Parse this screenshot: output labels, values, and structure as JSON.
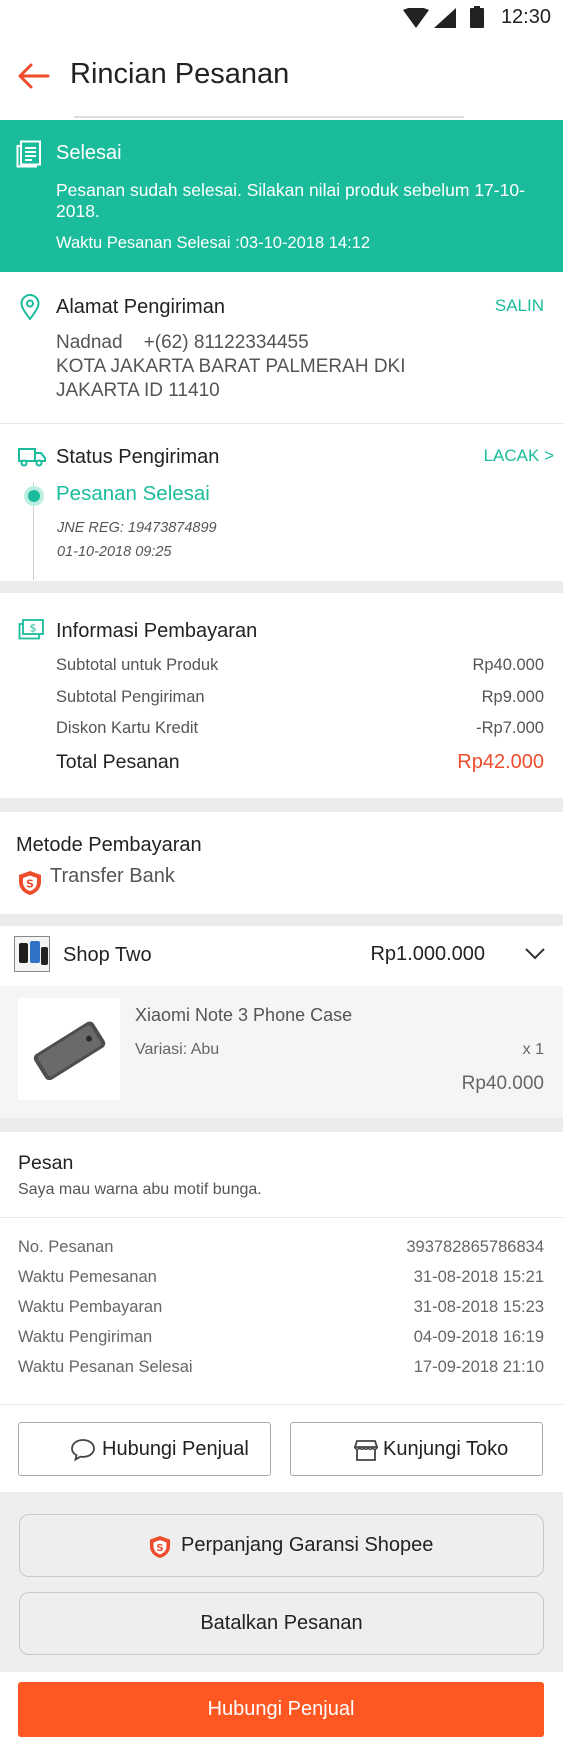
{
  "status_bar": {
    "time": "12:30"
  },
  "header": {
    "title": "Rincian Pesanan"
  },
  "banner": {
    "status": "Selesai",
    "message": "Pesanan sudah selesai. Silakan nilai produk sebelum 17-10-2018.",
    "completed_time": "Waktu Pesanan Selesai :03-10-2018 14:12"
  },
  "address": {
    "title": "Alamat Pengiriman",
    "copy_label": "SALIN",
    "name_phone": "Nadnad    +(62) 81122334455",
    "line1": "KOTA JAKARTA BARAT PALMERAH DKI",
    "line2": "JAKARTA ID 11410"
  },
  "shipping": {
    "title": "Status Pengiriman",
    "track_label": "LACAK >",
    "status": "Pesanan Selesai",
    "courier": "JNE REG: 19473874899",
    "date": "01-10-2018 09:25"
  },
  "payment_info": {
    "title": "Informasi Pembayaran",
    "rows": [
      {
        "label": "Subtotal untuk Produk",
        "value": "Rp40.000"
      },
      {
        "label": "Subtotal Pengiriman",
        "value": "Rp9.000"
      },
      {
        "label": "Diskon Kartu Kredit",
        "value": "-Rp7.000"
      }
    ],
    "total_label": "Total Pesanan",
    "total_value": "Rp42.000"
  },
  "payment_method": {
    "title": "Metode Pembayaran",
    "method": "Transfer Bank"
  },
  "shop": {
    "name": "Shop Two",
    "total": "Rp1.000.000",
    "product": {
      "name": "Xiaomi Note 3 Phone Case",
      "variant": "Variasi: Abu",
      "qty": "x 1",
      "price": "Rp40.000"
    }
  },
  "note": {
    "title": "Pesan",
    "text": "Saya mau warna abu motif bunga."
  },
  "order_details": [
    {
      "label": "No. Pesanan",
      "value": "393782865786834"
    },
    {
      "label": "Waktu Pemesanan",
      "value": "31-08-2018 15:21"
    },
    {
      "label": "Waktu Pembayaran",
      "value": "31-08-2018 15:23"
    },
    {
      "label": "Waktu Pengiriman",
      "value": "04-09-2018 16:19"
    },
    {
      "label": "Waktu Pesanan Selesai",
      "value": "17-09-2018 21:10"
    }
  ],
  "buttons": {
    "contact_seller": "Hubungi Penjual",
    "visit_shop": "Kunjungi Toko",
    "extend_warranty": "Perpanjang Garansi Shopee",
    "cancel_order": "Batalkan Pesanan",
    "bottom_contact": "Hubungi Penjual"
  },
  "colors": {
    "teal": "#1abc9c",
    "orange": "#ee4d2d",
    "bottom_button": "#fe5722"
  }
}
